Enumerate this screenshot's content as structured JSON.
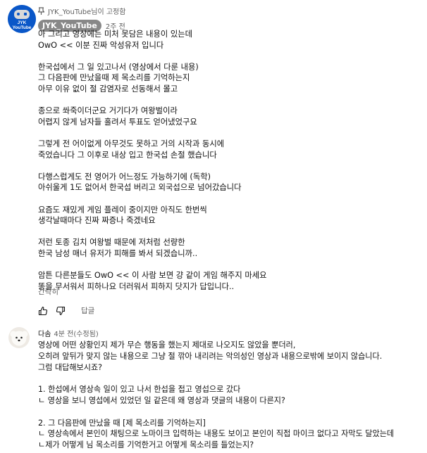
{
  "pinned_comment": {
    "pinned_by": "JYK_YouTube님이 고정함",
    "author": "JYK_YouTube",
    "time": "2주 전",
    "lines": [
      "아 그리고 영상에는 미처 못담은 내용이 있는데",
      "OwO << 이분 진짜 악성유저 입니다",
      "",
      "한국섭에서 그 일 있고나서 (영상에서 다룬 내용)",
      "그 다음판에 만났을때 제 목소리를 기억하는지",
      "아무 이유 없이 절 감염자로 선동해서 몰고",
      "",
      "종으로 쏴죽이더군요 거기다가 여왕벌이라",
      "어렵지 않게 남자들 홀려서 투표도 얻어냈었구요",
      "",
      "그렇게 전 어이없게 아무것도 못하고 거의 시작과 동시에",
      "죽었습니다 그 이후로 내상 입고 한국섭 손절 했습니다",
      "",
      "다행스럽게도 전 영어가 어느정도 가능하기에 (독학)",
      "아쉬울게 1도 없어서 한국섭 버리고 외국섭으로 넘어갔습니다",
      "",
      "요즘도 재밌게 게임 플레이 중이지만 아직도 한번씩",
      "생각날때마다 진짜 짜증나 죽겠네요",
      "",
      "저런 토종 김치 여왕벌 때문에 저처럼 선량한",
      "한국 남성 매너 유저가 피해를 봐서 되겠습니까..",
      "",
      "암튼 다른분들도 OwO << 이 사람 보면 걍 같이 게임 해주지 마세요",
      "똥을 무서워서 피하나요 더러워서 피하지 닷지가 답입니다.."
    ],
    "show_less": "간략히",
    "reply_label": "답글",
    "avatar_text": [
      "JYK",
      "YouTube"
    ]
  },
  "second_comment": {
    "author": "다솜",
    "time": "4분 전(수정됨)",
    "lines": [
      "영상에 어떤 상황인지 제가 무슨 행동을 했는지 제대로 나오지도 않았을 뿐더러,",
      "오히려 앞뒤가 맞지 않는 내용으로 그냥 절 깎아 내리려는 악의성인 영상과 내용으로밖에 보이지 않습니다.",
      "그럼 대답해보시죠?",
      "",
      "1. 한섭에서 영상속 일이 있고 나서 한섭을 접고 영섭으로 갔다",
      "ㄴ 영상을 보니 영섭에서 있었던 일 같은데 왜 영상과 댓글의 내용이 다른지?",
      "",
      "2. 그 다음판에 만났을 때 [제 목소리를 기억하는지]",
      "ㄴ 영상속에서 본인이 채팅으로 노마이크 입력하는 내용도 보이고 본인이 직접 마이크 없다고 자막도 달았는데",
      "ㄴ제가 어떻게 님 목소리를 기억한거고 어떻게 목소리를 들었는지?"
    ]
  },
  "colors": {
    "chip_bg": "#888888",
    "avatar_bg": "#0a57c8",
    "secondary_text": "#606060"
  }
}
